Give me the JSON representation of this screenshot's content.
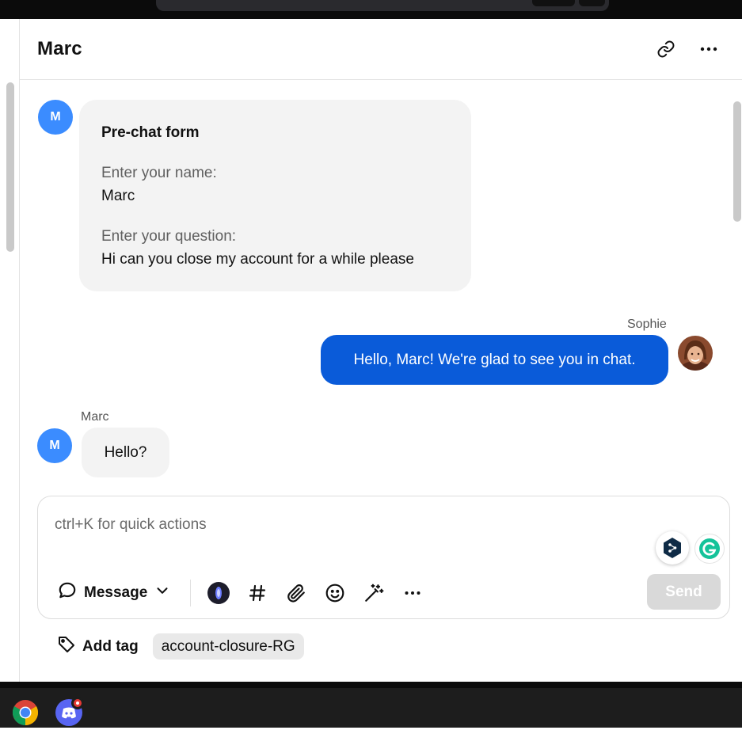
{
  "header": {
    "title": "Marc",
    "link_icon": "link-icon",
    "more_icon": "more-horizontal-icon"
  },
  "messages": {
    "form": {
      "avatar_initial": "M",
      "title": "Pre-chat form",
      "name_label": "Enter your name:",
      "name_value": "Marc",
      "question_label": "Enter your question:",
      "question_value": "Hi can you close my account for a while please"
    },
    "agent": {
      "sender": "Sophie",
      "text": "Hello, Marc! We're glad to see you in chat."
    },
    "customer": {
      "sender": "Marc",
      "avatar_initial": "M",
      "text": "Hello?"
    }
  },
  "composer": {
    "placeholder": "ctrl+K for quick actions",
    "message_type": "Message",
    "send_label": "Send",
    "tools": [
      "ai-assistant-icon",
      "hashtag-icon",
      "paperclip-icon",
      "emoji-icon",
      "magic-wand-icon",
      "more-horizontal-icon"
    ]
  },
  "tags": {
    "add_label": "Add tag",
    "items": [
      "account-closure-RG"
    ]
  },
  "colors": {
    "agent_bubble": "#0a5bd9",
    "avatar": "#3b8cff",
    "bubble_gray": "#f3f3f3",
    "send_disabled": "#d9d9d9"
  }
}
